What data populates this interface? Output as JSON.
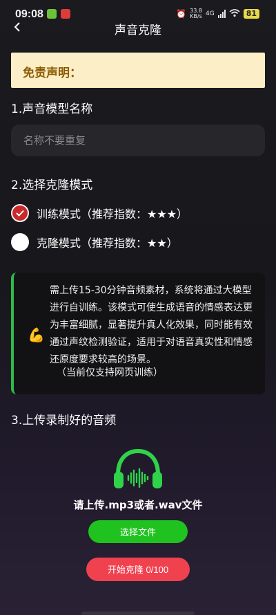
{
  "status_bar": {
    "time": "09:08",
    "net_speed_value": "33.8",
    "net_speed_unit": "KB/s",
    "network": "4G",
    "battery": "81"
  },
  "nav": {
    "title": "声音克隆",
    "back_icon": "chevron-left-icon"
  },
  "disclaimer": {
    "label": "免责声明："
  },
  "section1": {
    "title": "1.声音模型名称",
    "input_placeholder": "名称不要重复",
    "input_value": ""
  },
  "section2": {
    "title": "2.选择克隆模式",
    "options": [
      {
        "label": "训练模式（推荐指数：★★★）",
        "selected": true
      },
      {
        "label": "克隆模式（推荐指数：★★）",
        "selected": false
      }
    ]
  },
  "info_card": {
    "emoji": "💪",
    "text": "需上传15-30分钟音频素材，系统将通过大模型进行自训练。该模式可使生成语音的情感表达更为丰富细腻，显著提升真人化效果，同时能有效通过声纹检测验证，适用于对语音真实性和情感还原度要求较高的场景。",
    "note": "（当前仅支持网页训练）"
  },
  "section3": {
    "title": "3.上传录制好的音频",
    "upload_hint": "请上传.mp3或者.wav文件",
    "select_button": "选择文件",
    "start_button": "开始克隆 0/100"
  },
  "colors": {
    "accent_green": "#1fc21f",
    "accent_red": "#f0414f",
    "disclaimer_bg": "#fcefc7",
    "disclaimer_text": "#8a5a00"
  }
}
